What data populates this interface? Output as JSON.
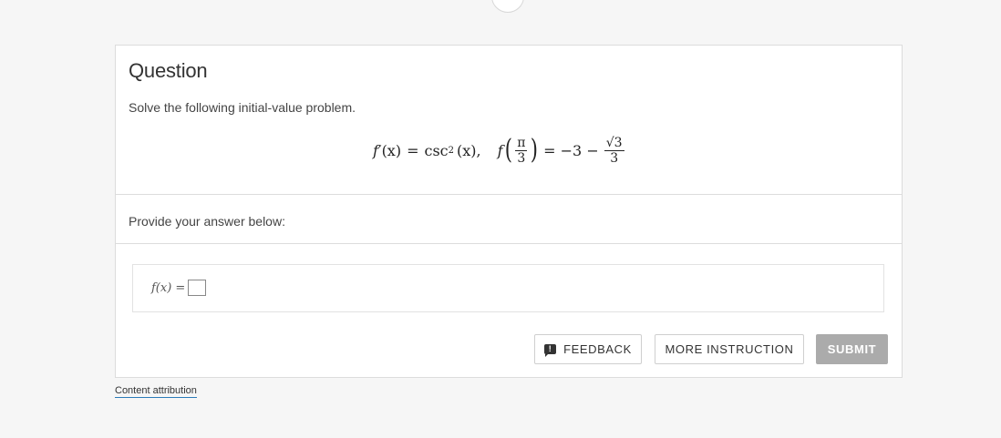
{
  "question": {
    "title": "Question",
    "prompt": "Solve the following initial-value problem.",
    "equation": {
      "lhs_func": "f′",
      "lhs_arg": "(x)",
      "equals": "=",
      "rhs": "csc",
      "rhs_power": "2",
      "rhs_arg": "(x),",
      "ic_func": "f",
      "ic_num": "π",
      "ic_den": "3",
      "ic_equals": "= −3 −",
      "ic_frac_num_radicand": "3",
      "ic_frac_den": "3"
    }
  },
  "answer": {
    "provide_label": "Provide your answer below:",
    "expr_label": "f(x) ="
  },
  "buttons": {
    "feedback": "FEEDBACK",
    "more_instruction": "MORE INSTRUCTION",
    "submit": "SUBMIT"
  },
  "footer": {
    "attribution": "Content attribution"
  },
  "icons": {
    "feedback_icon": "feedback-exclamation-icon"
  },
  "colors": {
    "submit_bg": "#ababab",
    "attribution_underline": "#2b7bb9"
  }
}
